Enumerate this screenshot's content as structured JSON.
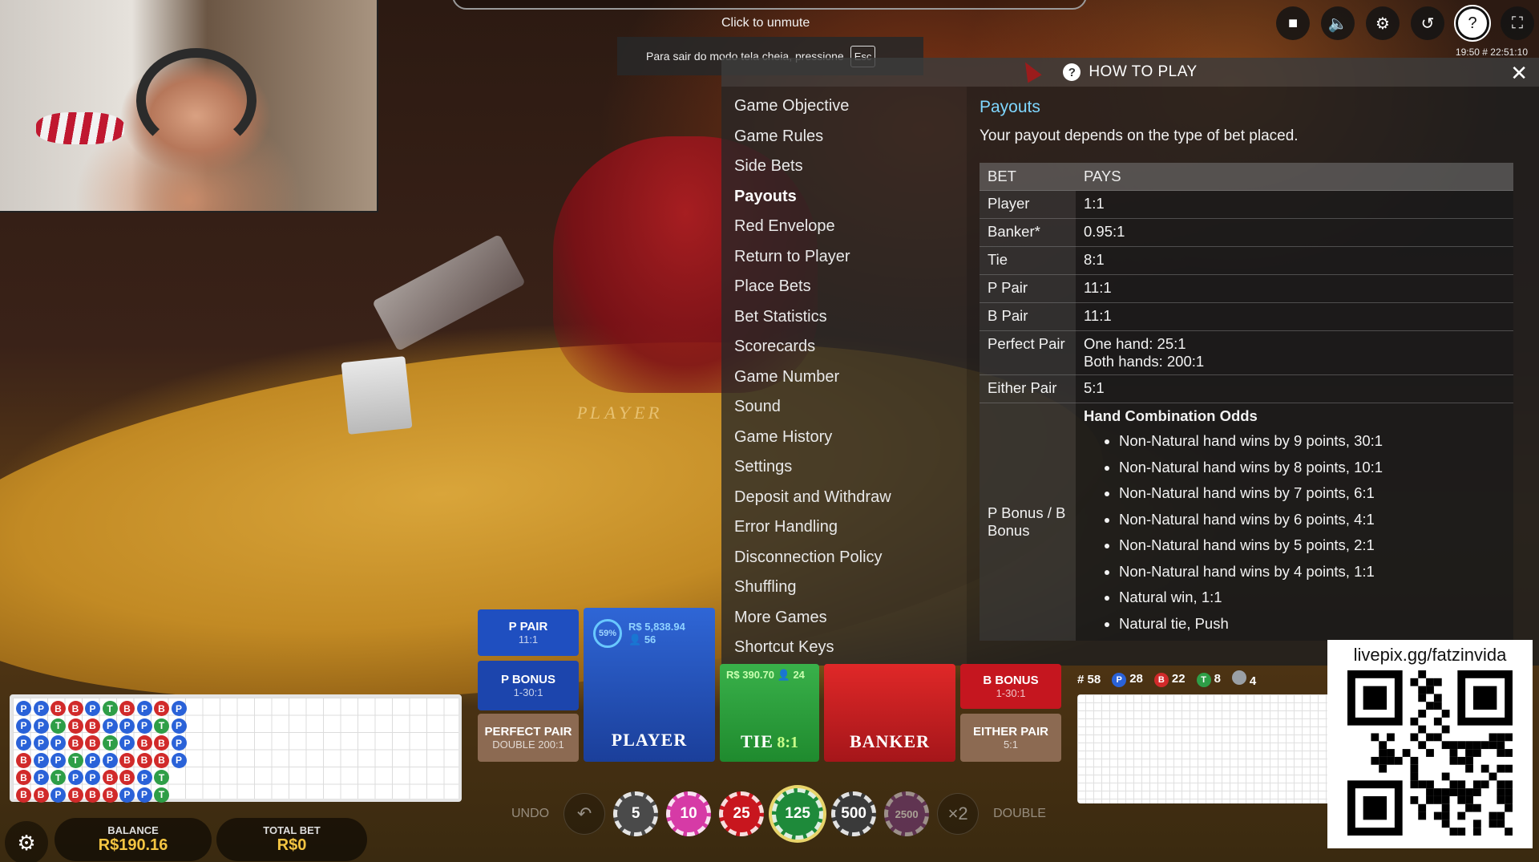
{
  "top": {
    "unmute": "Click to unmute",
    "fullscreen_note": "Para sair do modo tela cheia, pressione",
    "esc_key": "Esc",
    "clock": "19:50  # 22:51:10"
  },
  "controls": [
    {
      "icon": "video-icon",
      "glyph": "■"
    },
    {
      "icon": "sound-icon",
      "glyph": "🔈"
    },
    {
      "icon": "gear-icon",
      "glyph": "⚙"
    },
    {
      "icon": "history-icon",
      "glyph": "↺"
    },
    {
      "icon": "help-icon",
      "glyph": "?"
    },
    {
      "icon": "fullscreen-icon",
      "glyph": "⛶"
    }
  ],
  "how_to_play": {
    "title": "HOW TO PLAY",
    "close": "✕",
    "menu": [
      "Game Objective",
      "Game Rules",
      "Side Bets",
      "Payouts",
      "Red Envelope",
      "Return to Player",
      "Place Bets",
      "Bet Statistics",
      "Scorecards",
      "Game Number",
      "Sound",
      "Game History",
      "Settings",
      "Deposit and Withdraw",
      "Error Handling",
      "Disconnection Policy",
      "Shuffling",
      "More Games",
      "Shortcut Keys"
    ],
    "active_item": "Payouts",
    "content": {
      "title": "Payouts",
      "description": "Your payout depends on the type of bet placed.",
      "table_headers": [
        "BET",
        "PAYS"
      ],
      "rows": [
        {
          "bet": "Player",
          "pays": "1:1"
        },
        {
          "bet": "Banker*",
          "pays": "0.95:1"
        },
        {
          "bet": "Tie",
          "pays": "8:1"
        },
        {
          "bet": "P Pair",
          "pays": "11:1"
        },
        {
          "bet": "B Pair",
          "pays": "11:1"
        },
        {
          "bet": "Perfect Pair",
          "pays": "One hand: 25:1",
          "pays2": "Both hands: 200:1"
        },
        {
          "bet": "Either Pair",
          "pays": "5:1"
        }
      ],
      "bonus": {
        "bet": "P Bonus / B Bonus",
        "title": "Hand Combination Odds",
        "items": [
          "Non-Natural hand wins by 9 points, 30:1",
          "Non-Natural hand wins by 8 points, 10:1",
          "Non-Natural hand wins by 7 points, 6:1",
          "Non-Natural hand wins by 6 points, 4:1",
          "Non-Natural hand wins by 5 points, 2:1",
          "Non-Natural hand wins by 4 points, 1:1",
          "Natural win, 1:1",
          "Natural tie, Push"
        ]
      }
    }
  },
  "table_felt": {
    "label": "PLAYER"
  },
  "bets": {
    "p_pair": {
      "name": "P PAIR",
      "odds": "11:1"
    },
    "p_bonus": {
      "name": "P BONUS",
      "odds": "1-30:1"
    },
    "perfect_pair": {
      "name": "PERFECT PAIR",
      "odds": "DOUBLE 200:1"
    },
    "player": {
      "name": "PLAYER",
      "percent": "59%",
      "amount": "R$ 5,838.94",
      "players": "56"
    },
    "tie": {
      "name": "TIE",
      "odds": "8:1",
      "amount": "R$ 390.70",
      "players": "24"
    },
    "banker": {
      "name": "BANKER"
    },
    "b_bonus": {
      "name": "B BONUS",
      "odds": "1-30:1"
    },
    "either_pair": {
      "name": "EITHER PAIR",
      "odds": "5:1"
    }
  },
  "chips_row": {
    "undo": "UNDO",
    "undo_glyph": "↶",
    "chips": [
      {
        "value": "5",
        "color": "#4a4a4a"
      },
      {
        "value": "10",
        "color": "#d63aa6"
      },
      {
        "value": "25",
        "color": "#c8161e"
      },
      {
        "value": "125",
        "color": "#1e8a3a"
      },
      {
        "value": "500",
        "color": "#3a3a3a"
      },
      {
        "value": "2500",
        "color": "#7b3a86"
      }
    ],
    "selected_chip": "125",
    "double_x": "×2",
    "double": "DOUBLE"
  },
  "road": {
    "counts": [
      {
        "label": "# 58",
        "color": ""
      },
      {
        "label": "28",
        "badge": "P",
        "color": "#2a62d8"
      },
      {
        "label": "22",
        "badge": "B",
        "color": "#d12a2a"
      },
      {
        "label": "8",
        "badge": "T",
        "color": "#2e9e47"
      },
      {
        "label": "4",
        "badge": "",
        "color": "#9aa0a6"
      }
    ],
    "bead_rows": [
      [
        "P",
        "P",
        "B",
        "B",
        "P",
        "T",
        "B",
        "P",
        "B",
        "P"
      ],
      [
        "P",
        "P",
        "T",
        "B",
        "B",
        "P",
        "P",
        "P",
        "T",
        "P"
      ],
      [
        "P",
        "P",
        "P",
        "B",
        "B",
        "T",
        "P",
        "B",
        "B",
        "P"
      ],
      [
        "B",
        "P",
        "P",
        "T",
        "P",
        "P",
        "B",
        "B",
        "B",
        "P"
      ],
      [
        "B",
        "P",
        "T",
        "P",
        "P",
        "B",
        "B",
        "P",
        "T",
        ""
      ],
      [
        "B",
        "B",
        "P",
        "B",
        "B",
        "B",
        "P",
        "P",
        "T",
        ""
      ]
    ]
  },
  "wallet": {
    "balance_label": "BALANCE",
    "balance_value": "R$190.16",
    "total_bet_label": "TOTAL BET",
    "total_bet_value": "R$0"
  },
  "overlay": {
    "qr_url": "livepix.gg/fatzinvida"
  }
}
